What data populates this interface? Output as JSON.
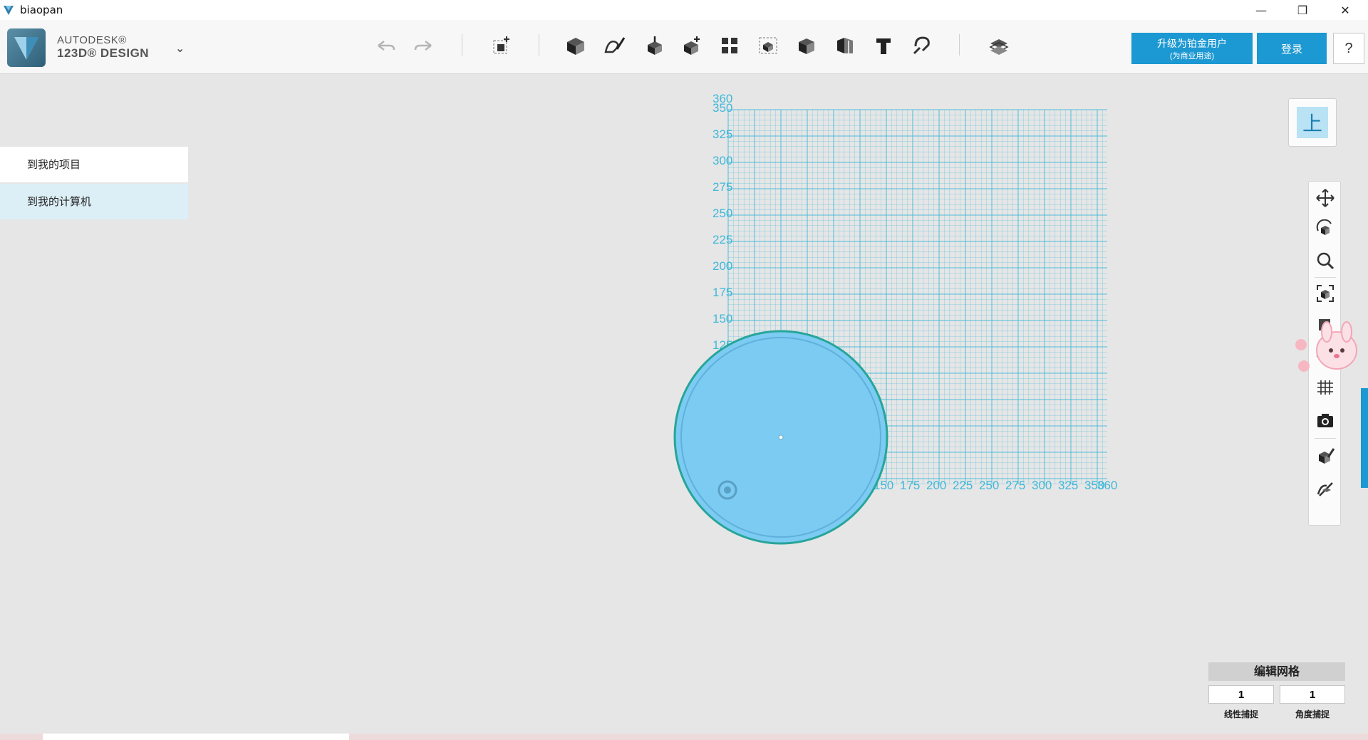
{
  "window": {
    "title": "biaopan",
    "minimize_glyph": "—",
    "maximize_glyph": "❐",
    "close_glyph": "✕"
  },
  "brand": {
    "line1": "AUTODESK®",
    "line2": "123D® DESIGN",
    "menu_chevron": "⌄"
  },
  "toolbar": {
    "icons": [
      "undo-icon",
      "redo-icon",
      "transform-icon",
      "primitives-icon",
      "sketch-icon",
      "construct-icon",
      "modify-icon",
      "pattern-icon",
      "grouping-icon",
      "combine-icon",
      "measure-icon",
      "text-icon",
      "snap-icon",
      "material-icon"
    ],
    "upgrade_label": "升级为铂金用户",
    "upgrade_sub": "(为商业用途)",
    "login_label": "登录",
    "help_label": "?"
  },
  "left_panel": {
    "items": [
      {
        "label": "到我的项目"
      },
      {
        "label": "到我的计算机"
      }
    ]
  },
  "viewport": {
    "grid_color": "#3fb8d9",
    "circle_fill": "#7ccbf2",
    "circle_outline": "#27a59a",
    "y_ticks": [
      "360",
      "350",
      "325",
      "300",
      "275",
      "250",
      "225",
      "200",
      "175",
      "150",
      "125"
    ],
    "x_ticks": [
      "150",
      "175",
      "200",
      "225",
      "250",
      "275",
      "300",
      "325",
      "350",
      "360"
    ]
  },
  "view_cube": {
    "face_label": "上"
  },
  "nav_bar": {
    "icons": [
      "pan-icon",
      "orbit-icon",
      "zoom-icon",
      "fit-icon",
      "visibility-icon",
      "grid-view-icon",
      "camera-icon",
      "materials-icon",
      "outline-icon"
    ]
  },
  "grid_edit": {
    "title": "编辑网格",
    "linear_snap_value": "1",
    "angle_snap_value": "1",
    "linear_snap_label": "线性捕捉",
    "angle_snap_label": "角度捕捉"
  },
  "colors": {
    "accent": "#1c98d2",
    "background": "#e6e6e6"
  }
}
